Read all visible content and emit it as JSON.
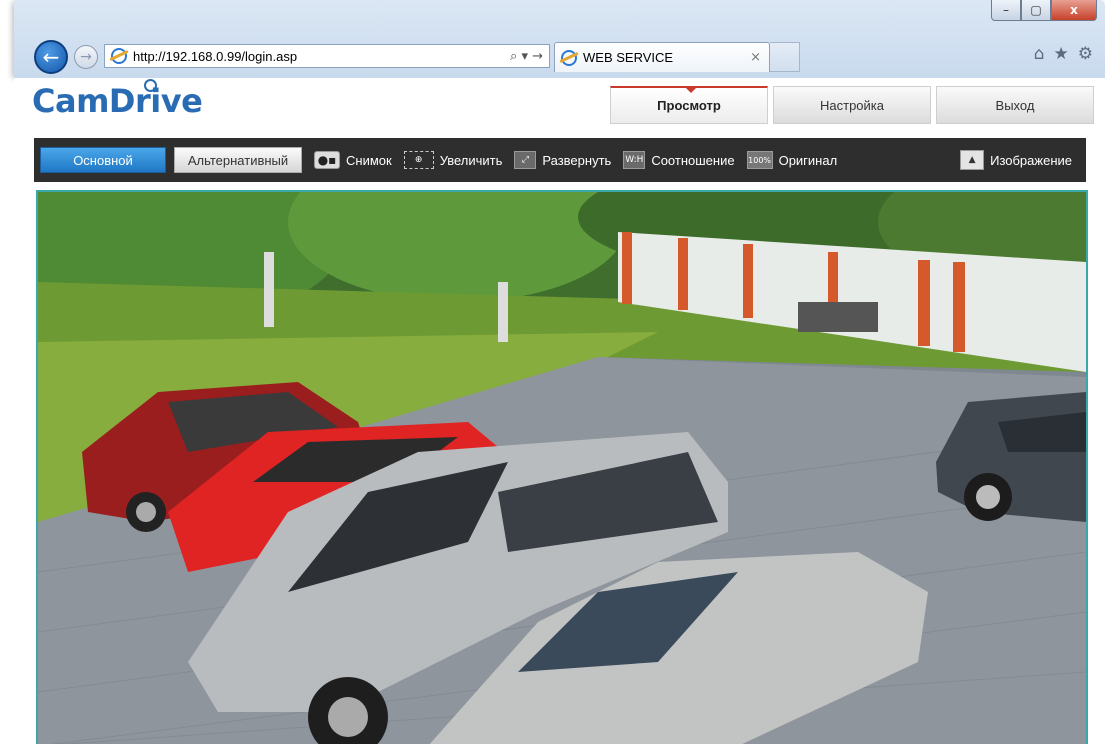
{
  "browser": {
    "url": "http://192.168.0.99/login.asp",
    "address_tools": "⌕ ▾ →",
    "tab_title": "WEB SERVICE",
    "tab_close": "×",
    "window_controls": [
      "–",
      "▢",
      "x"
    ],
    "toolbar_icons": [
      "home-icon",
      "star-icon",
      "gear-icon"
    ]
  },
  "app": {
    "logo": "CamDrive",
    "accent_color": "#2a6cb4",
    "tabs": [
      {
        "label": "Просмотр",
        "active": true
      },
      {
        "label": "Настройка",
        "active": false
      },
      {
        "label": "Выход",
        "active": false
      }
    ]
  },
  "toolbar": {
    "stream_primary": "Основной",
    "stream_alternate": "Альтернативный",
    "snapshot": "Снимок",
    "zoom": "Увеличить",
    "expand": "Развернуть",
    "ratio": "Соотношение",
    "ratio_icon": "W:H",
    "original": "Оригинал",
    "original_icon": "100%",
    "image": "Изображение"
  }
}
